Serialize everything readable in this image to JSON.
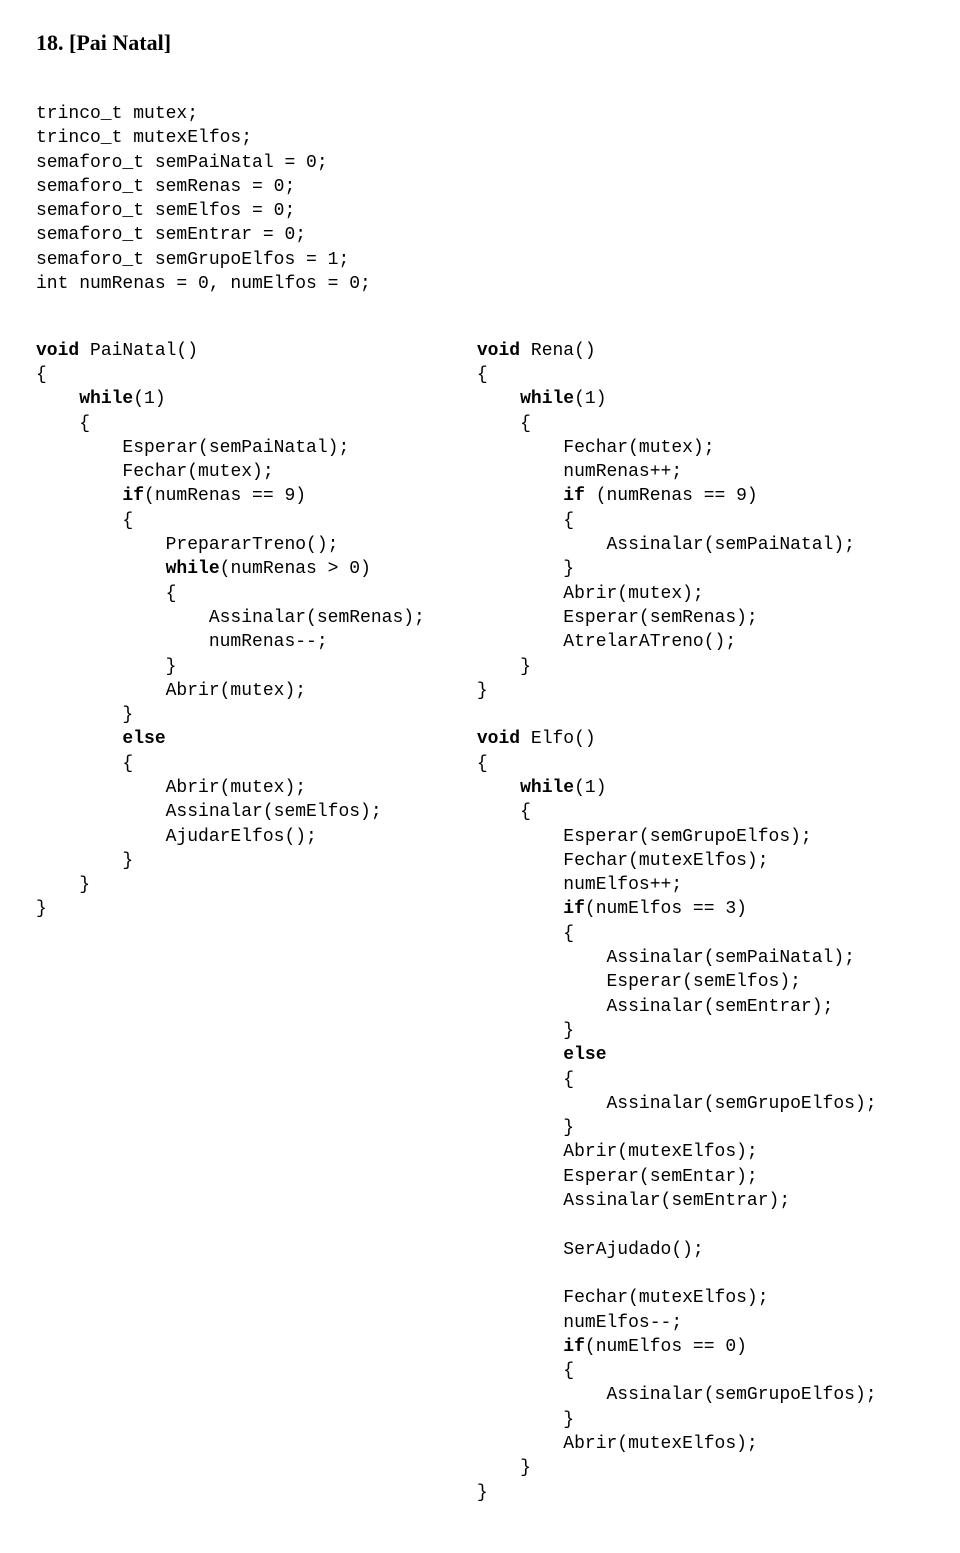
{
  "heading": "18.  [Pai Natal]",
  "decls": {
    "d1": "trinco_t mutex;",
    "d2": "trinco_t mutexElfos;",
    "d3": "semaforo_t semPaiNatal = 0;",
    "d4": "semaforo_t semRenas = 0;",
    "d5": "semaforo_t semElfos = 0;",
    "d6": "semaforo_t semEntrar = 0;",
    "d7": "semaforo_t semGrupoElfos = 1;",
    "d8": "int numRenas = 0, numElfos = 0;"
  },
  "L": {
    "k_void": "void",
    "fn_PaiNatal": " PaiNatal()",
    "ob": "{",
    "k_while1": "while",
    "p_while1": "(1)",
    "ob2": "{",
    "l_esperar": "Esperar(semPaiNatal);",
    "l_fechar": "Fechar(mutex);",
    "k_if": "if",
    "p_if": "(numRenas == 9)",
    "ob3": "{",
    "l_prep": "PrepararTreno();",
    "k_while2": "while",
    "p_while2": "(numRenas > 0)",
    "ob4": "{",
    "l_assR": "Assinalar(semRenas);",
    "l_dec": "numRenas--;",
    "cb4": "}",
    "l_abrir1": "Abrir(mutex);",
    "cb3": "}",
    "k_else": "else",
    "ob5": "{",
    "l_abrir2": "Abrir(mutex);",
    "l_assE": "Assinalar(semElfos);",
    "l_ajE": "AjudarElfos();",
    "cb5": "}",
    "cb2": "}",
    "cb1": "}"
  },
  "R": {
    "k_void_r": "void",
    "fn_Rena": " Rena()",
    "r_ob": "{",
    "k_while_r": "while",
    "p_while_r": "(1)",
    "r_ob2": "{",
    "r_fechar": "Fechar(mutex);",
    "r_inc": "numRenas++;",
    "k_if_r": "if",
    "p_if_r": " (numRenas == 9)",
    "r_ob3": "{",
    "r_assPN": "Assinalar(semPaiNatal);",
    "r_cb3": "}",
    "r_abrir": "Abrir(mutex);",
    "r_espR": "Esperar(semRenas);",
    "r_atr": "AtrelarATreno();",
    "r_cb2": "}",
    "r_cb1": "}",
    "k_void_e": "void",
    "fn_Elfo": " Elfo()",
    "e_ob": "{",
    "k_while_e": "while",
    "p_while_e": "(1)",
    "e_ob2": "{",
    "e_espGE": "Esperar(semGrupoElfos);",
    "e_fechar1": "Fechar(mutexElfos);",
    "e_inc": "numElfos++;",
    "k_if_e": "if",
    "p_if_e": "(numElfos == 3)",
    "e_ob3": "{",
    "e_assPN": "Assinalar(semPaiNatal);",
    "e_espSE": "Esperar(semElfos);",
    "e_assEnt1": "Assinalar(semEntrar);",
    "e_cb3": "}",
    "k_else_e": "else",
    "e_ob4": "{",
    "e_assGE1": "Assinalar(semGrupoElfos);",
    "e_cb4": "}",
    "e_abrir1": "Abrir(mutexElfos);",
    "e_espEnt": "Esperar(semEntar);",
    "e_assEnt2": "Assinalar(semEntrar);",
    "e_blank": "",
    "e_serAj": "SerAjudado();",
    "e_blank2": "",
    "e_fechar2": "Fechar(mutexElfos);",
    "e_dec": "numElfos--;",
    "k_if_e2": "if",
    "p_if_e2": "(numElfos == 0)",
    "e_ob5": "{",
    "e_assGE2": "Assinalar(semGrupoElfos);",
    "e_cb5": "}",
    "e_abrir2": "Abrir(mutexElfos);",
    "e_cb2": "}",
    "e_cb1": "}"
  }
}
